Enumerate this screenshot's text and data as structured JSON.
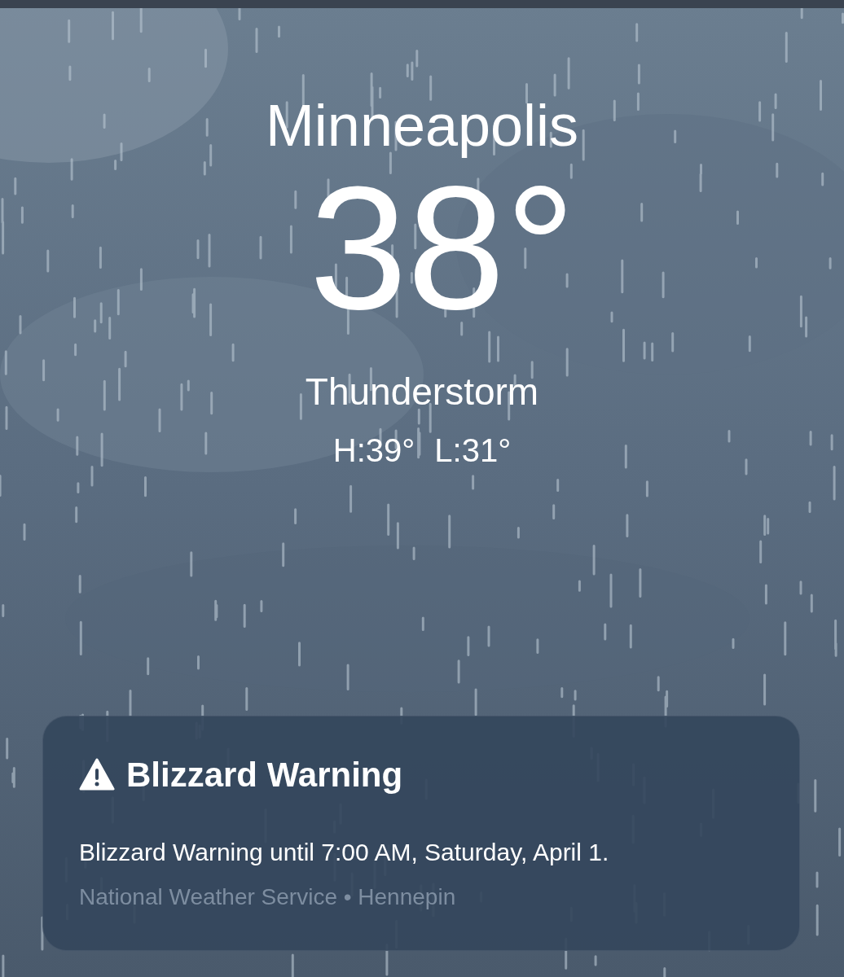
{
  "location": "Minneapolis",
  "temperature": "38°",
  "condition": "Thunderstorm",
  "high": "H:39°",
  "low": "L:31°",
  "alert": {
    "title": "Blizzard Warning",
    "message": "Blizzard Warning until 7:00 AM, Saturday, April 1.",
    "source": "National Weather Service • Hennepin"
  }
}
